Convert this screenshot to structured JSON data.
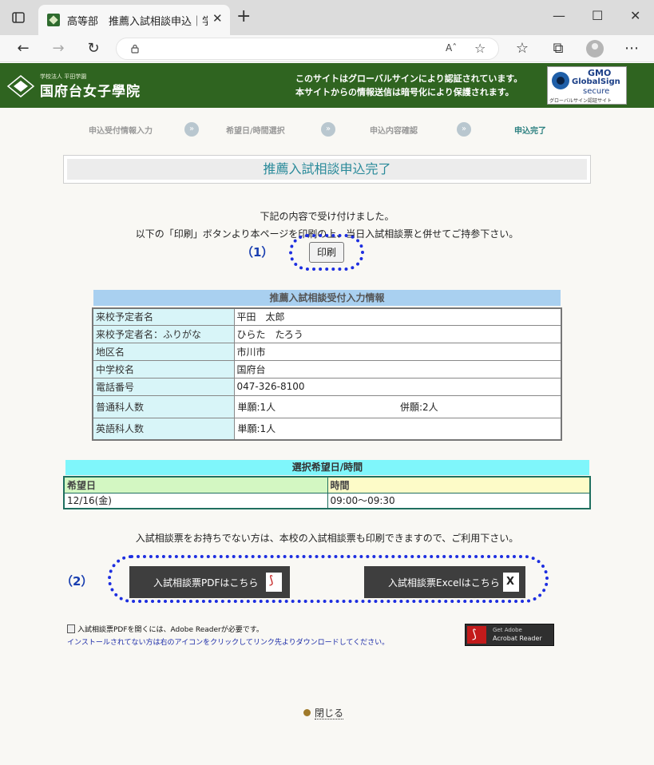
{
  "browser": {
    "tab_title": "高等部　推薦入試相談申込｜学",
    "tab_close": "✕",
    "new_tab": "+",
    "minimize": "—",
    "maximize": "☐",
    "close": "✕",
    "back": "←",
    "forward": "→",
    "reload": "↻",
    "read_aloud": "Aˆ",
    "favorite": "☆",
    "favorites_bar": "☆",
    "collections": "⧉",
    "more": "⋯"
  },
  "header": {
    "logo_sub": "学校法人 平田学園",
    "logo_main": "国府台女子學院",
    "message": "このサイトはグローバルサインにより認証されています。本サイトからの情報送信は暗号化により保護されます。",
    "gs_gmo": "GMO",
    "gs_name": "GlobalSign",
    "gs_secure": "secure",
    "gs_foot": "グローバルサイン認証サイト"
  },
  "steps": [
    "申込受付情報入力",
    "希望日/時間選択",
    "申込内容確認",
    "申込完了"
  ],
  "step_arrow": "»",
  "title": "推薦入試相談申込完了",
  "message1": "下記の内容で受け付けました。",
  "message2": "以下の「印刷」ボタンより本ページを印刷の上、当日入試相談票と併せてご持参下さい。",
  "label_1": "（1）",
  "print_button": "印刷",
  "info_table": {
    "heading": "推薦入試相談受付入力情報",
    "rows": [
      {
        "key": "来校予定者名",
        "value": "平田　太郎"
      },
      {
        "key": "来校予定者名：ふりがな",
        "value": "ひらた　たろう"
      },
      {
        "key": "地区名",
        "value": "市川市"
      },
      {
        "key": "中学校名",
        "value": "国府台"
      },
      {
        "key": "電話番号",
        "value": "047-326-8100"
      }
    ],
    "regular": {
      "key": "普通科人数",
      "single": "単願:1人",
      "combined": "併願:2人"
    },
    "english": {
      "key": "英語科人数",
      "single": "単願:1人"
    }
  },
  "selection_table": {
    "heading": "選択希望日/時間",
    "col_date": "希望日",
    "col_time": "時間",
    "date": "12/16(金)",
    "time": "09:00〜09:30"
  },
  "message3": "入試相談票をお持ちでない方は、本校の入試相談票も印刷できますので、ご利用下さい。",
  "label_2": "（2）",
  "pdf_button": "入試相談票PDFはこちら",
  "excel_button": "入試相談票Excelはこちら",
  "note1": "入試相談票PDFを開くには、Adobe Readerが必要です。",
  "note2": "インストールされてない方は右のアイコンをクリックしてリンク先よりダウンロードしてください。",
  "adobe": {
    "line1": "Get Adobe",
    "line2": "Acrobat Reader"
  },
  "close_link": "閉じる"
}
